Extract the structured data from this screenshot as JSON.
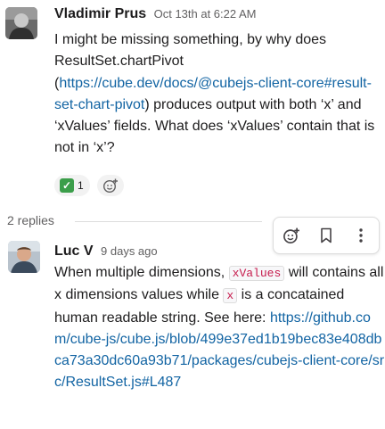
{
  "messages": [
    {
      "author": "Vladimir Prus",
      "timestamp": "Oct 13th at 6:22 AM",
      "avatar_icon": "user-avatar-photo",
      "text_part1": "I might be missing something, by why does ResultSet.chartPivot (",
      "link": "https://cube.dev/docs/@cubejs-client-core#result-set-chart-pivot",
      "text_part2": ") produces output with both ‘x’ and ‘xValues’ fields. What does ‘xValues’ contain that is not in ‘x’?",
      "reactions": [
        {
          "emoji": "white-check-mark-icon",
          "count": "1"
        }
      ],
      "add_reaction_icon": "add-emoji-icon"
    },
    {
      "author": "Luc V",
      "timestamp": "9 days ago",
      "avatar_icon": "user-avatar-photo",
      "text_part1": "When multiple dimensions, ",
      "code1": "xValues",
      "text_part2": " will contains all x dimensions values while ",
      "code2": "x",
      "text_part3": "  is a concatained human readable string. See here: ",
      "link": "https://github.com/cube-js/cube.js/blob/499e37ed1b19bec83e408dbca73a30dc60a93b71/packages/cubejs-client-core/src/ResultSet.js#L487"
    }
  ],
  "thread": {
    "replies_label": "2 replies"
  },
  "toolbar": {
    "buttons": [
      "add-reaction-icon",
      "bookmark-icon",
      "more-actions-icon"
    ]
  },
  "colors": {
    "link": "#1264a3",
    "code_text": "#c61a4c",
    "reaction_check": "#3b9e4a"
  }
}
